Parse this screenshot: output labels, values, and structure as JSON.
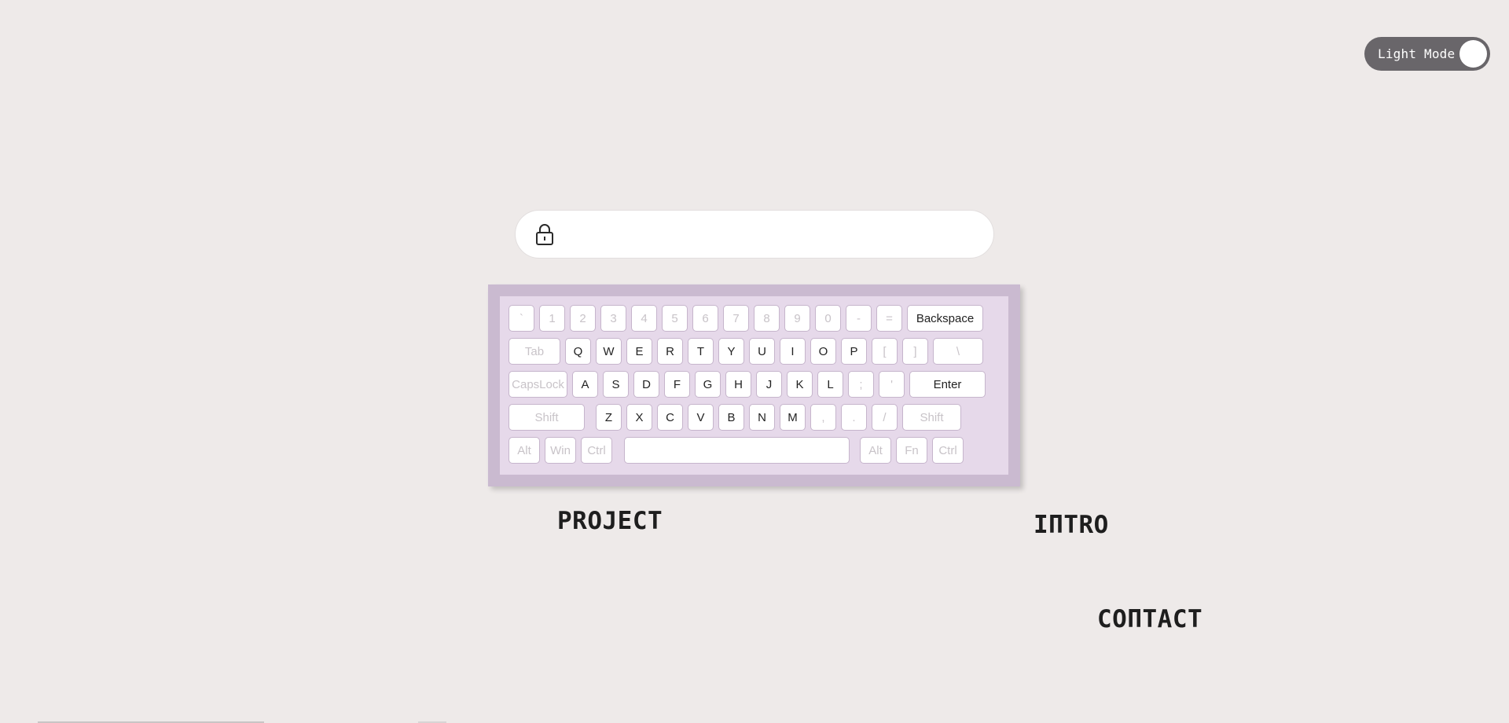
{
  "theme_toggle": {
    "label": "Light Mode"
  },
  "password": {
    "value": "",
    "placeholder": ""
  },
  "keyboard": {
    "rows": [
      [
        {
          "label": "`",
          "dim": true
        },
        {
          "label": "1",
          "dim": true
        },
        {
          "label": "2",
          "dim": true
        },
        {
          "label": "3",
          "dim": true
        },
        {
          "label": "4",
          "dim": true
        },
        {
          "label": "5",
          "dim": true
        },
        {
          "label": "6",
          "dim": true
        },
        {
          "label": "7",
          "dim": true
        },
        {
          "label": "8",
          "dim": true
        },
        {
          "label": "9",
          "dim": true
        },
        {
          "label": "0",
          "dim": true
        },
        {
          "label": "-",
          "dim": true
        },
        {
          "label": "=",
          "dim": true
        },
        {
          "label": "Backspace",
          "dim": false
        }
      ],
      [
        {
          "label": "Tab",
          "dim": true
        },
        {
          "label": "Q",
          "dim": false
        },
        {
          "label": "W",
          "dim": false
        },
        {
          "label": "E",
          "dim": false
        },
        {
          "label": "R",
          "dim": false
        },
        {
          "label": "T",
          "dim": false
        },
        {
          "label": "Y",
          "dim": false
        },
        {
          "label": "U",
          "dim": false
        },
        {
          "label": "I",
          "dim": false
        },
        {
          "label": "O",
          "dim": false
        },
        {
          "label": "P",
          "dim": false
        },
        {
          "label": "[",
          "dim": true
        },
        {
          "label": "]",
          "dim": true
        },
        {
          "label": "\\",
          "dim": true
        }
      ],
      [
        {
          "label": "CapsLock",
          "dim": true
        },
        {
          "label": "A",
          "dim": false
        },
        {
          "label": "S",
          "dim": false
        },
        {
          "label": "D",
          "dim": false
        },
        {
          "label": "F",
          "dim": false
        },
        {
          "label": "G",
          "dim": false
        },
        {
          "label": "H",
          "dim": false
        },
        {
          "label": "J",
          "dim": false
        },
        {
          "label": "K",
          "dim": false
        },
        {
          "label": "L",
          "dim": false
        },
        {
          "label": ";",
          "dim": true
        },
        {
          "label": "'",
          "dim": true
        },
        {
          "label": "Enter",
          "dim": false
        }
      ],
      [
        {
          "label": "Shift",
          "dim": true
        },
        {
          "label": "Z",
          "dim": false
        },
        {
          "label": "X",
          "dim": false
        },
        {
          "label": "C",
          "dim": false
        },
        {
          "label": "V",
          "dim": false
        },
        {
          "label": "B",
          "dim": false
        },
        {
          "label": "N",
          "dim": false
        },
        {
          "label": "M",
          "dim": false
        },
        {
          "label": ",",
          "dim": true
        },
        {
          "label": ".",
          "dim": true
        },
        {
          "label": "/",
          "dim": true
        },
        {
          "label": "Shift",
          "dim": true
        }
      ],
      [
        {
          "label": "Alt",
          "dim": true
        },
        {
          "label": "Win",
          "dim": true
        },
        {
          "label": "Ctrl",
          "dim": true
        },
        {
          "label": "",
          "dim": false
        },
        {
          "label": "Alt",
          "dim": true
        },
        {
          "label": "Fn",
          "dim": true
        },
        {
          "label": "Ctrl",
          "dim": true
        }
      ]
    ]
  },
  "nav": {
    "project": "PROJECT",
    "intro": "IПTRO",
    "contact": "COПTACT"
  },
  "colors": {
    "background": "#eeeae9",
    "toggle": "#69666a",
    "keyboard_case": "#cabad0",
    "keyboard_plate": "#e6d9ea",
    "key_border": "#c6b5cc"
  }
}
